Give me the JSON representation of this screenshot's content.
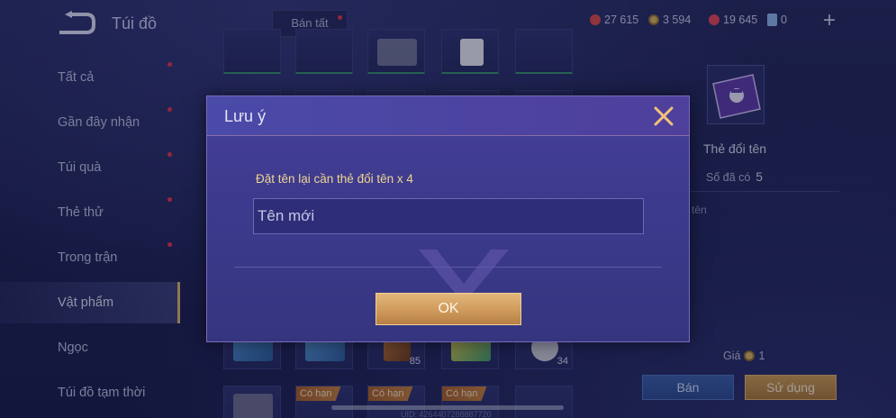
{
  "header": {
    "title": "Túi đồ",
    "sell_all_label": "Bán tất",
    "currencies": [
      {
        "name": "red-gem-icon",
        "value": "27 615",
        "color": "#d84a4a"
      },
      {
        "name": "gold-coin-icon",
        "value": "3 594",
        "color": "#d4b060"
      },
      {
        "name": "red-voucher-icon",
        "value": "19 645",
        "color": "#e0455a"
      },
      {
        "name": "card-icon",
        "value": "0",
        "color": "#8ab4e8"
      }
    ]
  },
  "sidebar": {
    "items": [
      {
        "label": "Tất cả",
        "dot": true
      },
      {
        "label": "Gần đây nhận",
        "dot": true
      },
      {
        "label": "Túi quà",
        "dot": true
      },
      {
        "label": "Thẻ thử",
        "dot": true
      },
      {
        "label": "Trong trận",
        "dot": true
      },
      {
        "label": "Vật phẩm",
        "active": true
      },
      {
        "label": "Ngọc"
      },
      {
        "label": "Túi đồ tạm thời"
      }
    ]
  },
  "grid": {
    "counts": [
      "85",
      "34"
    ],
    "limited_label": "Có hạn"
  },
  "detail": {
    "name": "Thẻ đổi tên",
    "owned_label": "Số đã có",
    "owned_value": "5",
    "desc": "tên",
    "price_label": "Giá",
    "price_value": "1",
    "sell_button": "Bán",
    "use_button": "Sử dụng"
  },
  "dialog": {
    "title": "Lưu ý",
    "message": "Đặt tên lại cần thẻ đổi tên x 4",
    "input_placeholder": "Tên mới",
    "input_value": "",
    "ok_label": "OK"
  },
  "footer": {
    "uid": "UID: 4264407288887720"
  }
}
